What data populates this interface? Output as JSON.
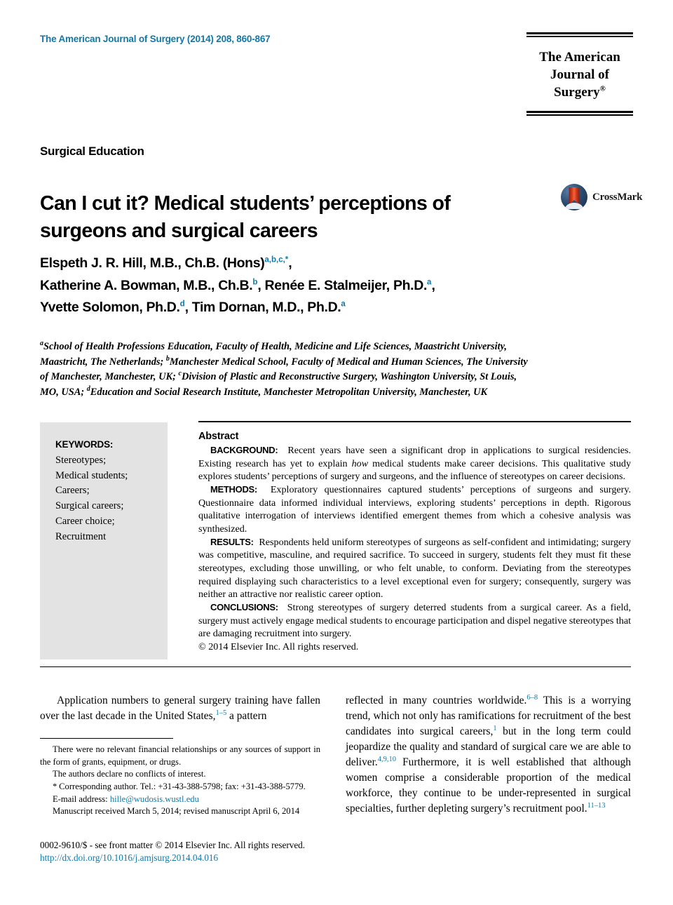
{
  "header": {
    "journal_reference": "The American Journal of Surgery (2014) 208, 860-867",
    "logo_line1": "The American",
    "logo_line2": "Journal of Surgery",
    "logo_trademark": "®"
  },
  "article": {
    "section_label": "Surgical Education",
    "title": "Can I cut it? Medical students’ perceptions of surgeons and surgical careers",
    "crossmark_label": "CrossMark",
    "authors_line1_name": "Elspeth J. R. Hill, M.B., Ch.B. (Hons)",
    "authors_line1_sup": "a,b,c,",
    "authors_line1_star": "*",
    "authors_line1_tail": ",",
    "authors_line2_a": "Katherine A. Bowman, M.B., Ch.B.",
    "authors_line2_a_sup": "b",
    "authors_line2_b": ", Renée E. Stalmeijer, Ph.D.",
    "authors_line2_b_sup": "a",
    "authors_line2_tail": ",",
    "authors_line3_a": "Yvette Solomon, Ph.D.",
    "authors_line3_a_sup": "d",
    "authors_line3_b": ", Tim Dornan, M.D., Ph.D.",
    "authors_line3_b_sup": "a",
    "affiliation_a_sup": "a",
    "affiliation_a": "School of Health Professions Education, Faculty of Health, Medicine and Life Sciences, Maastricht University, Maastricht, The Netherlands; ",
    "affiliation_b_sup": "b",
    "affiliation_b": "Manchester Medical School, Faculty of Medical and Human Sciences, The University of Manchester, Manchester, UK; ",
    "affiliation_c_sup": "c",
    "affiliation_c": "Division of Plastic and Reconstructive Surgery, Washington University, St Louis, MO, USA; ",
    "affiliation_d_sup": "d",
    "affiliation_d": "Education and Social Research Institute, Manchester Metropolitan University, Manchester, UK"
  },
  "keywords": {
    "title": "KEYWORDS:",
    "items": "Stereotypes; Medical students; Careers; Surgical careers; Career choice; Recruitment",
    "list": [
      "Stereotypes;",
      "Medical students;",
      "Careers;",
      "Surgical careers;",
      "Career choice;",
      "Recruitment"
    ]
  },
  "abstract": {
    "title": "Abstract",
    "background_label": "BACKGROUND:",
    "background_text_1": "Recent years have seen a significant drop in applications to surgical residencies. Existing research has yet to explain ",
    "background_italic": "how",
    "background_text_2": " medical students make career decisions. This qualitative study explores students’ perceptions of surgery and surgeons, and the influence of stereotypes on career decisions.",
    "methods_label": "METHODS:",
    "methods_text": "Exploratory questionnaires captured students’ perceptions of surgeons and surgery. Questionnaire data informed individual interviews, exploring students’ perceptions in depth. Rigorous qualitative interrogation of interviews identified emergent themes from which a cohesive analysis was synthesized.",
    "results_label": "RESULTS:",
    "results_text": "Respondents held uniform stereotypes of surgeons as self-confident and intimidating; surgery was competitive, masculine, and required sacrifice. To succeed in surgery, students felt they must fit these stereotypes, excluding those unwilling, or who felt unable, to conform. Deviating from the stereotypes required displaying such characteristics to a level exceptional even for surgery; consequently, surgery was neither an attractive nor realistic career option.",
    "conclusions_label": "CONCLUSIONS:",
    "conclusions_text": "Strong stereotypes of surgery deterred students from a surgical career. As a field, surgery must actively engage medical students to encourage participation and dispel negative stereotypes that are damaging recruitment into surgery.",
    "copyright": "© 2014 Elsevier Inc. All rights reserved."
  },
  "body": {
    "left_para_1": "Application numbers to general surgery training have fallen over the last decade in the United States,",
    "left_para_1_ref": "1–5",
    "left_para_1_tail": " a pattern",
    "right_para_1": "reflected in many countries worldwide.",
    "right_para_1_ref": "6–8",
    "right_para_2": " This is a worrying trend, which not only has ramifications for recruitment of the best candidates into surgical careers,",
    "right_para_2_ref": "1",
    "right_para_3": " but in the long term could jeopardize the quality and standard of surgical care we are able to deliver.",
    "right_para_3_ref": "4,9,10",
    "right_para_4": " Furthermore, it is well established that although women comprise a considerable proportion of the medical workforce, they continue to be under-represented in surgical specialties, further depleting surgery’s recruitment pool.",
    "right_para_4_ref": "11–13"
  },
  "footnotes": {
    "disclosure": "There were no relevant financial relationships or any sources of support in the form of grants, equipment, or drugs.",
    "conflicts": "The authors declare no conflicts of interest.",
    "corresponding_star": "*",
    "corresponding": " Corresponding author. Tel.: +31-43-388-5798; fax: +31-43-388-5779.",
    "email_label": "E-mail address: ",
    "email_link": "hille@wudosis.wustl.edu",
    "manuscript": "Manuscript received March 5, 2014; revised manuscript April 6, 2014"
  },
  "page_footer": {
    "issn": "0002-9610/$ - see front matter © 2014 Elsevier Inc. All rights reserved.",
    "doi": "http://dx.doi.org/10.1016/j.amjsurg.2014.04.016"
  },
  "colors": {
    "link_blue": "#1278a8",
    "keywords_bg": "#e3e3e3",
    "crossmark_red": "#d63a18",
    "crossmark_navy": "#142c49"
  }
}
